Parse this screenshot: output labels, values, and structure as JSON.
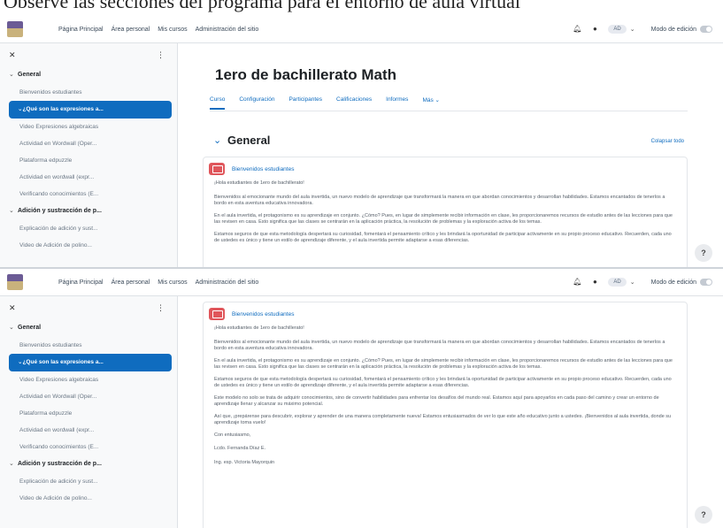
{
  "caption_top": "Observe las secciones del programa para el entorno de aula virtual",
  "navbar": {
    "links": [
      "Página Principal",
      "Área personal",
      "Mis cursos",
      "Administración del sitio"
    ],
    "user_initials": "AD",
    "edit_mode_label": "Modo de edición"
  },
  "drawer": {
    "sections": [
      {
        "title": "General",
        "items": [
          "Bienvenidos estudiantes"
        ]
      },
      {
        "title": "¿Qué son las expresiones a...",
        "active": true,
        "items": [
          "Video Expresiones algebraicas",
          "Actividad en Wordwall (Oper...",
          "Plataforma edpuzzle",
          "Actividad en wordwall (expr...",
          "Verificando conocimientos (E..."
        ]
      },
      {
        "title": "Adición y sustracción de p...",
        "items": [
          "Explicación de adición y sust...",
          "Video de Adición de polino..."
        ]
      }
    ]
  },
  "course": {
    "title": "1ero de bachillerato Math",
    "tabs": [
      "Curso",
      "Configuración",
      "Participantes",
      "Calificaciones",
      "Informes",
      "Más"
    ],
    "section_title": "General",
    "collapse_all": "Colapsar todo",
    "activity_title": "Bienvenidos estudiantes",
    "paragraphs": [
      "¡Hola estudiantes de 1ero de bachillerato!",
      "Bienvenidos al emocionante mundo del aula invertida, un nuevo modelo de aprendizaje que transformará la manera en que abordan conocimientos y desarrollan habilidades. Estamos encantados de tenerlos a bordo en esta aventura educativa innovadora.",
      "En el aula invertida, el protagonismo es su aprendizaje en conjunto. ¿Cómo? Pues, en lugar de simplemente recibir información en clase, les proporcionaremos recursos de estudio antes de las lecciones para que las revisen en casa. Esto significa que las clases se centrarán en la aplicación práctica, la resolución de problemas y la exploración activa de los temas.",
      "Estamos seguros de que esta metodología despertará su curiosidad, fomentará el pensamiento crítico y les brindará la oportunidad de participar activamente en su propio proceso educativo. Recuerden, cada uno de ustedes es único y tiene un estilo de aprendizaje diferente, y el aula invertida permite adaptarse a esas diferencias.",
      "Este modelo no solo se trata de adquirir conocimientos, sino de convertir habilidades para enfrentar los desafíos del mundo real. Estamos aquí para apoyarlos en cada paso del camino y crear un entorno de aprendizaje llenar y alcanzar su máximo potencial.",
      "Así que, ¡prepárense para descubrir, explorar y aprender de una manera completamente nueva! Estamos entusiasmados de ver lo que este año educativo junto a ustedes. ¡Bienvenidos al aula invertida, donde su aprendizaje toma vuelo!",
      "Con entusiasmo,",
      "Lcdo. Fernanda Díaz E.",
      "Ing. esp. Victoria Mayorquin"
    ]
  }
}
